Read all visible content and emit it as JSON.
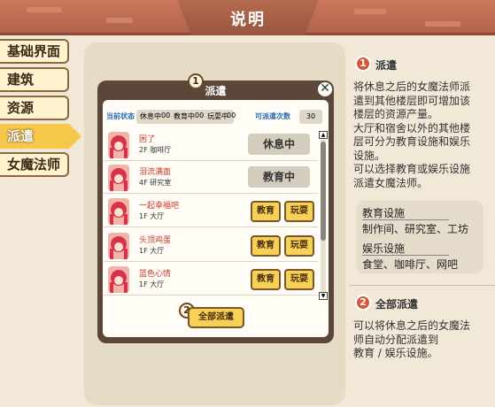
{
  "header": {
    "title": "说明"
  },
  "sidebar": {
    "items": [
      {
        "label": "基础界面"
      },
      {
        "label": "建筑"
      },
      {
        "label": "资源"
      },
      {
        "label": "派遣"
      },
      {
        "label": "女魔法师"
      }
    ],
    "active_index": 3
  },
  "dialog": {
    "badge_number": "1",
    "title": "派遣",
    "current_status_label": "当前状态",
    "statuses": [
      {
        "label": "休息中",
        "count": "00"
      },
      {
        "label": "教育中",
        "count": "00"
      },
      {
        "label": "玩耍中",
        "count": "00"
      }
    ],
    "dispatch_label": "可派遣次数",
    "dispatch_count": "30",
    "rows": [
      {
        "name": "困了",
        "floor": "2F",
        "room": "咖啡厅",
        "action": "休息中"
      },
      {
        "name": "泪流满面",
        "floor": "4F",
        "room": "研究室",
        "action": "教育中"
      },
      {
        "name": "一起幸福吧",
        "floor": "1F",
        "room": "大厅",
        "btn1": "教育",
        "btn2": "玩耍"
      },
      {
        "name": "头顶鸡蛋",
        "floor": "1F",
        "room": "大厅",
        "btn1": "教育",
        "btn2": "玩耍"
      },
      {
        "name": "蓝色心情",
        "floor": "1F",
        "room": "大厅",
        "btn1": "教育",
        "btn2": "玩耍"
      }
    ],
    "deploy_badge": "2",
    "deploy_button": "全部派遣"
  },
  "right": {
    "s1_badge": "1",
    "s1_title": "派遣",
    "s1_lines": [
      "将休息之后的女魔法师派",
      "遣到其他楼层即可增加该",
      "楼层的资源产量。",
      "大厅和宿舍以外的其他楼",
      "层可分为教育设施和娱乐",
      "设施。",
      "可以选择教育或娱乐设施",
      "派遣女魔法师。"
    ],
    "edu_title": "教育设施",
    "edu_list": "制作间、研究室、工坊",
    "ent_title": "娱乐设施",
    "ent_list": "食堂、咖啡厅、网吧",
    "s2_badge": "2",
    "s2_title": "全部派遣",
    "s2_lines": [
      "可以将休息之后的女魔法",
      "师自动分配派遣到",
      "教育 / 娱乐设施。"
    ]
  }
}
